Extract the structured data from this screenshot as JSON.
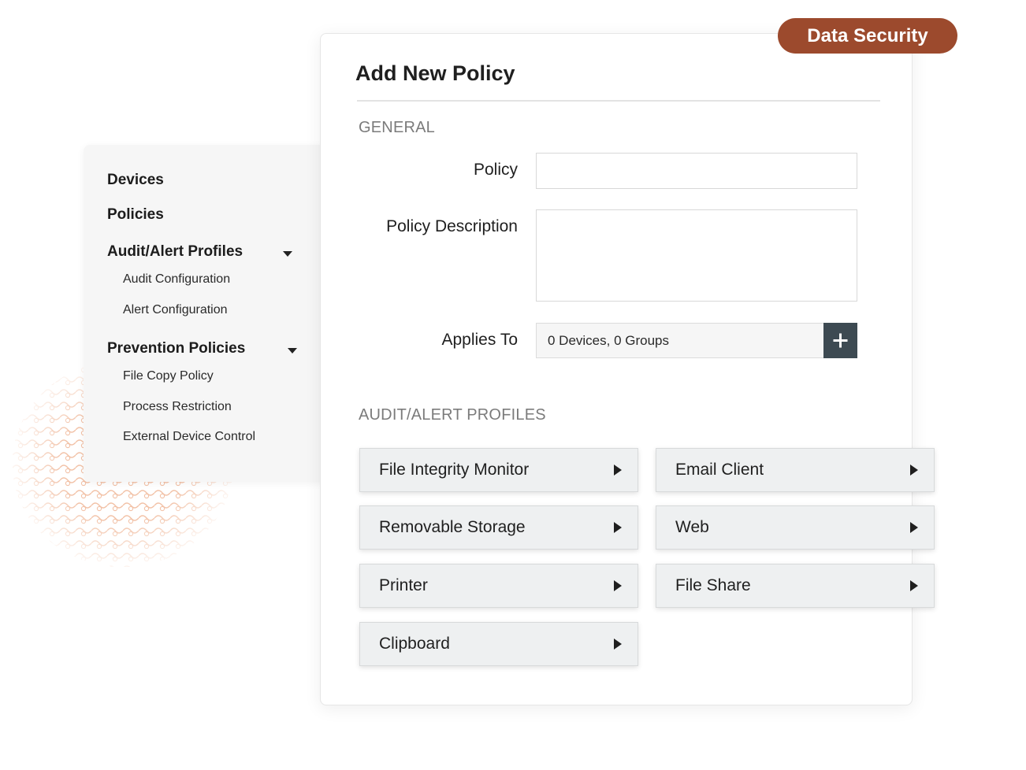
{
  "badge": {
    "label": "Data Security"
  },
  "colors": {
    "badge": "#9c4a2d",
    "add_button": "#3d4a52",
    "pattern": "#f2c1a6"
  },
  "sidebar": {
    "items": [
      {
        "label": "Devices",
        "kind": "item"
      },
      {
        "label": "Policies",
        "kind": "item"
      },
      {
        "label": "Audit/Alert Profiles",
        "kind": "group",
        "expanded": true,
        "children": [
          "Audit Configuration",
          "Alert Configuration"
        ]
      },
      {
        "label": "Prevention Policies",
        "kind": "group",
        "expanded": true,
        "children": [
          "File Copy Policy",
          "Process Restriction",
          "External Device Control"
        ]
      }
    ]
  },
  "form": {
    "title": "Add New Policy",
    "general_heading": "GENERAL",
    "policy_label": "Policy",
    "policy_value": "",
    "policy_description_label": "Policy Description",
    "policy_description_value": "",
    "applies_to_label": "Applies To",
    "applies_to_value": "0 Devices, 0 Groups",
    "add_icon": "plus-icon",
    "profiles_heading": "AUDIT/ALERT PROFILES",
    "profiles": [
      "File Integrity Monitor",
      "Email Client",
      "Removable Storage",
      "Web",
      "Printer",
      "File Share",
      "Clipboard"
    ]
  }
}
